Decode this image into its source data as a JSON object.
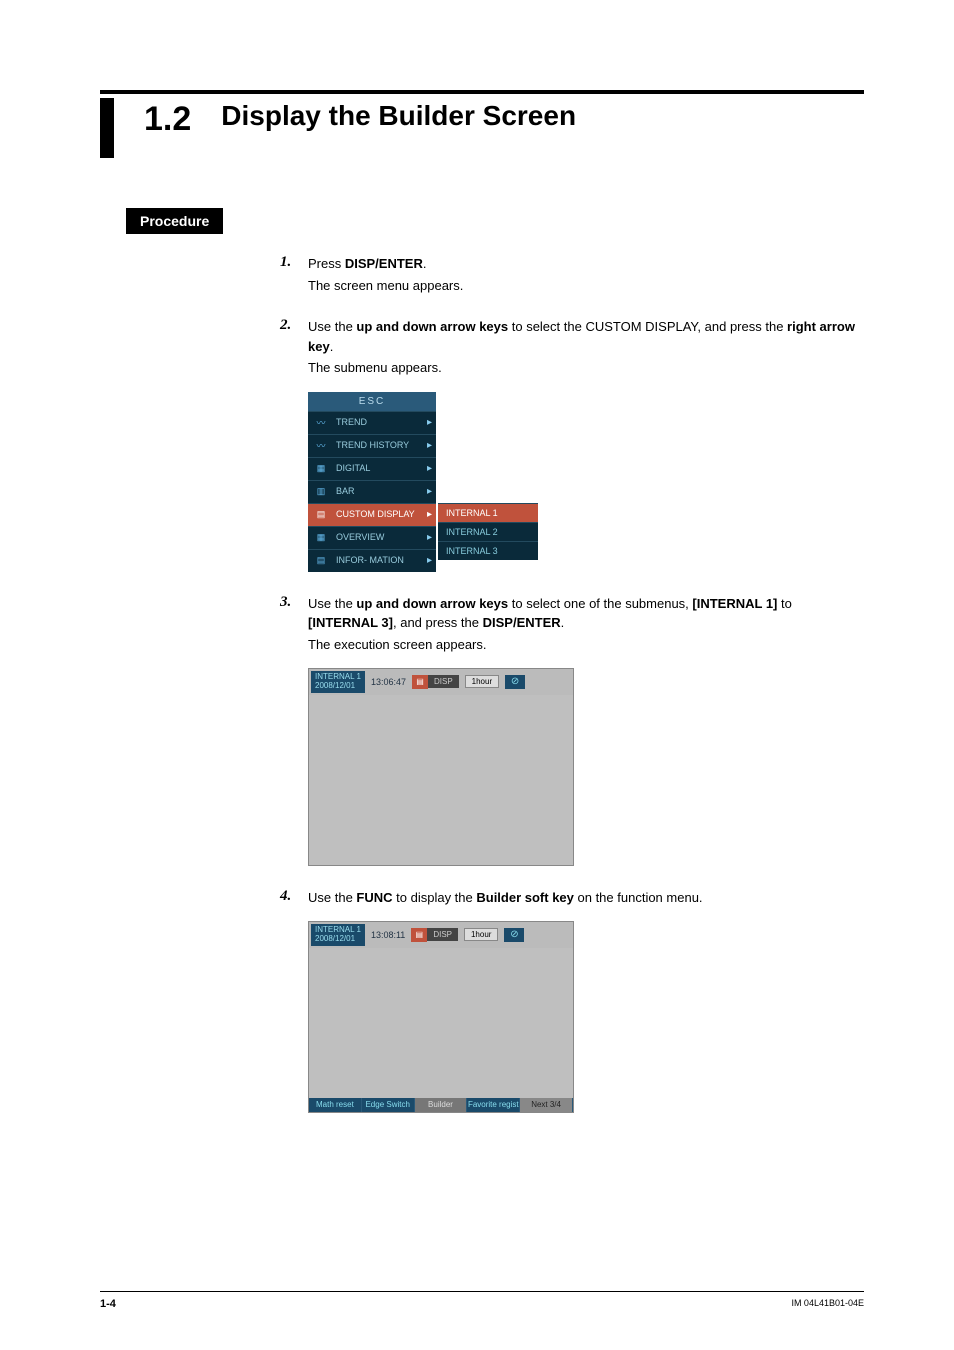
{
  "section": {
    "number": "1.2",
    "title": "Display the Builder Screen"
  },
  "procedure_label": "Procedure",
  "steps": [
    {
      "n": "1.",
      "pre": "Press ",
      "b1": "DISP/ENTER",
      "post": ".",
      "note": "The screen menu appears."
    },
    {
      "n": "2.",
      "pre": "Use the ",
      "b1": "up and down arrow keys",
      "mid": " to select the CUSTOM DISPLAY, and press the ",
      "b2": "right arrow key",
      "post": ".",
      "note": "The submenu appears."
    },
    {
      "n": "3.",
      "pre": "Use the ",
      "b1": "up and down arrow keys",
      "mid": " to select one of the submenus, ",
      "b2": "[INTERNAL 1]",
      "mid2": " to ",
      "b3": "[INTERNAL 3]",
      "mid3": ", and press the ",
      "b4": "DISP/ENTER",
      "post": ".",
      "note": "The execution screen appears."
    },
    {
      "n": "4.",
      "pre": "Use the ",
      "b1": "FUNC",
      "mid": " to display the ",
      "b2": "Builder soft key",
      "post": " on the function menu."
    }
  ],
  "menu": {
    "esc": "ESC",
    "items": [
      {
        "label": "TREND",
        "icon": "〰"
      },
      {
        "label": "TREND HISTORY",
        "icon": "〰"
      },
      {
        "label": "DIGITAL",
        "icon": "▦"
      },
      {
        "label": "BAR",
        "icon": "▥"
      },
      {
        "label": "CUSTOM DISPLAY",
        "icon": "▤",
        "sel": true
      },
      {
        "label": "OVERVIEW",
        "icon": "▦"
      },
      {
        "label": "INFOR- MATION",
        "icon": "▤"
      }
    ],
    "sub": [
      "INTERNAL 1",
      "INTERNAL 2",
      "INTERNAL 3"
    ]
  },
  "screen1": {
    "id": "INTERNAL 1",
    "date": "2008/12/01",
    "time": "13:06:47",
    "disp": "DISP",
    "rate": "1hour"
  },
  "screen2": {
    "id": "INTERNAL 1",
    "date": "2008/12/01",
    "time": "13:08:11",
    "disp": "DISP",
    "rate": "1hour",
    "softkeys": [
      "Math reset",
      "Edge Switch",
      "Builder",
      "Favorite regist",
      "Next 3/4"
    ]
  },
  "footer": {
    "page": "1-4",
    "doc": "IM 04L41B01-04E"
  }
}
